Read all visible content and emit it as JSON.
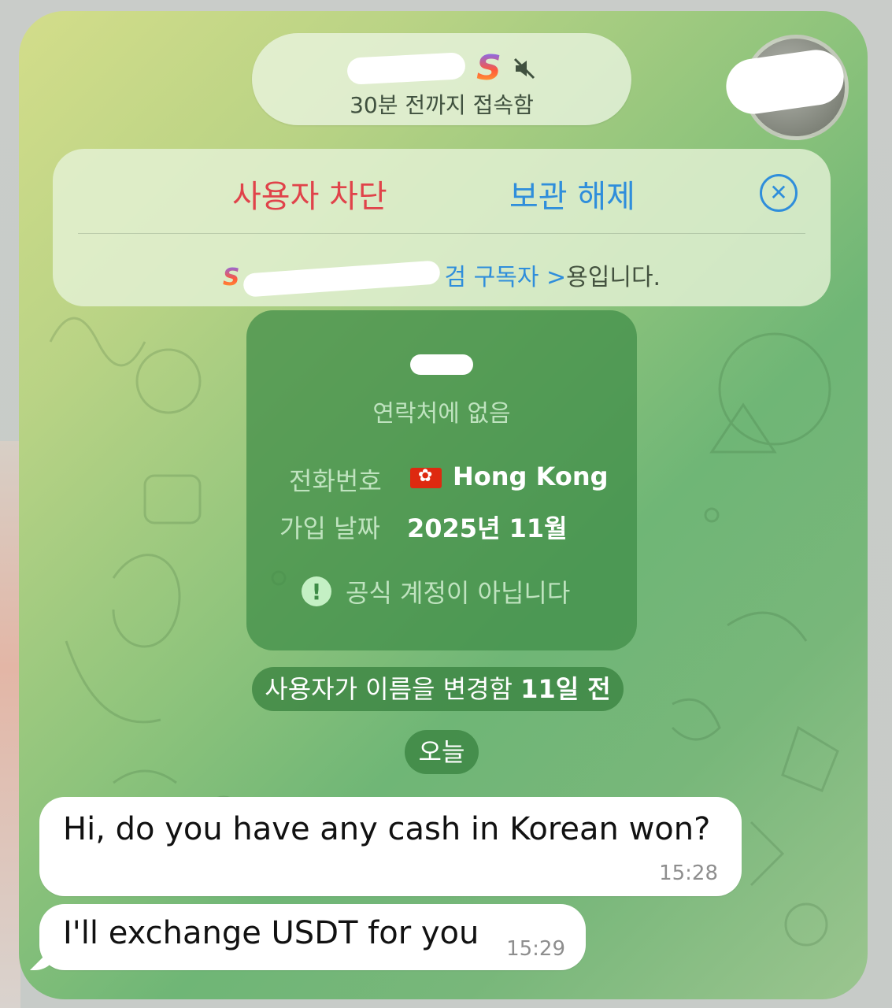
{
  "header": {
    "logo_letter": "S",
    "status": "30분 전까지 접속함"
  },
  "actions": {
    "block_label": "사용자 차단",
    "unarchive_label": "보관 해제",
    "close_symbol": "✕",
    "subscriber_link": "검 구독자 >",
    "subscriber_suffix": "용입니다."
  },
  "info": {
    "not_in_contacts": "연락처에 없음",
    "phone_label": "전화번호",
    "phone_value": "Hong Kong",
    "joined_label": "가입 날짜",
    "joined_value": "2025년 11월",
    "warning": "공식 계정이 아닙니다"
  },
  "service": {
    "name_changed": "사용자가 이름을 변경함",
    "name_changed_when": "11일 전",
    "today": "오늘"
  },
  "messages": [
    {
      "text": "Hi, do you have any cash in Korean won?",
      "time": "15:28"
    },
    {
      "text": "I'll exchange USDT for you",
      "time": "15:29"
    }
  ],
  "colors": {
    "block_red": "#e0434a",
    "link_blue": "#2f8edb",
    "info_card_green": "#3e8c46"
  },
  "icons": [
    "mute-icon",
    "close-circle-icon",
    "hk-flag-icon",
    "warning-icon"
  ]
}
